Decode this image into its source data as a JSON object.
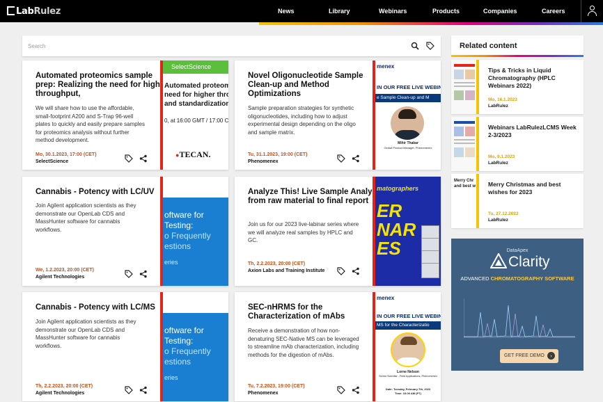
{
  "nav": {
    "logo_a": "Lab",
    "logo_b": "Rulez",
    "items": [
      "News",
      "Library",
      "Webinars",
      "Products",
      "Companies",
      "Careers"
    ]
  },
  "search": {
    "placeholder": "Search"
  },
  "cards": [
    {
      "title": "Automated proteomics sample prep: Realizing the need for higher throughput,",
      "desc": "We will share how to use the affordable, small-footprint A200 and S-Trap 96-well plates to quickly and easily prepare samples for proteomics analysis without further method development.",
      "date": "Mo, 30.1.2023, 17:00 (CET)",
      "org": "SelectScience",
      "thumb": {
        "brand": "SelectScience",
        "lines": [
          "Automated proteomics",
          "need for higher thro",
          "and standardization"
        ],
        "time": "0, at 16:00 GMT / 17:00 CE",
        "logo": "TECAN."
      }
    },
    {
      "title": "Novel Oligonucleotide Sample Clean-up and Method Optimizations",
      "desc": "Sample preparation strategies for synthetic oligonucleotides, including how to adjust experimental design depending on the oligo and sample matrix.",
      "date": "Tu, 31.1.2023, 19:00 (CET)",
      "org": "Phenomenex",
      "thumb": {
        "brand": "menex",
        "banner": "IN OUR FREE LIVE WEBIN",
        "sub": "e Sample Clean-up and M",
        "name": "Mihir Thakar",
        "role": "Global Product Manager, Phenomenex"
      }
    },
    {
      "title": "Cannabis - Potency with LC/UV",
      "desc": "Join Agilent application scientists as they demonstrate our OpenLab CDS and MassHunter software for cannabis workflows.",
      "date": "We, 1.2.2023, 20:00 (CET)",
      "org": "Agilent Technologies",
      "thumb": {
        "lines": [
          "oftware for",
          "Testing:",
          "o Frequently",
          "estions",
          "eries"
        ]
      }
    },
    {
      "title": "Analyze This! Live Sample Analysis from raw material to final report",
      "desc": "Join us for our 2023 live-labinar series where we will analyze real samples by HPLC and GC.",
      "date": "Th, 2.2.2023, 20:00 (CET)",
      "org": "Axion Labs and Training Institute",
      "thumb": {
        "lines": [
          "matographers",
          "ER",
          "NAR",
          "ES"
        ]
      }
    },
    {
      "title": "Cannabis - Potency with LC/MS",
      "desc": "Join Agilent application scientists as they demonstrate our OpenLab CDS and MassHunter software for cannabis workflows.",
      "date": "Th, 2.2.2023, 20:00 (CET)",
      "org": "Agilent Technologies",
      "thumb": {
        "lines": [
          "oftware for",
          "Testing:",
          "o Frequently",
          "estions",
          "eries"
        ]
      }
    },
    {
      "title": "SEC-nHRMS for the Characterization of mAbs",
      "desc": "Receive a demonstration of how non-denaturing SEC-Native MS can be leveraged to streamline mAb characterization, including methods for the digestion of mAbs.",
      "date": "Tu, 7.2.2023, 19:00 (CET)",
      "org": "Phenomenex",
      "thumb": {
        "brand": "menex",
        "banner": "IN OUR FREE LIVE WEBIN",
        "sub": "MS for the Characterizatio",
        "name": "Lorne Nelson",
        "role": "Senior Scientist - Field Applications, Phenomenex",
        "when": "Date: Tuesday, February 7th, 2023",
        "time": "Time: 10:00 AM (PT)"
      }
    }
  ],
  "related": {
    "heading": "Related content",
    "items": [
      {
        "title": "Tips & Tricks in Liquid Chromatography (HPLC Webinars 2022)",
        "date": "Mo, 16.1.2023",
        "org": "LabRulez"
      },
      {
        "title": "Webinars LabRulezLCMS Week 2-3/2023",
        "date": "Mo, 9.1.2023",
        "org": "LabRulez"
      },
      {
        "title": "Merry Christmas and best wishes for 2023",
        "date": "Tu, 27.12.2022",
        "org": "LabRulez",
        "thumb_text": [
          "Merry Chr",
          "and best w"
        ]
      }
    ]
  },
  "ad": {
    "brand": "DataApex",
    "product": "Clarity",
    "tag_a": "ADVANCED ",
    "tag_b": "CHROMATOGRAPHY SOFTWARE",
    "cta": "GET FREE DEMO"
  },
  "colors": {
    "accent_red": "#e32419",
    "accent_yellow": "#f5c400",
    "date_orange": "#c4501a"
  }
}
